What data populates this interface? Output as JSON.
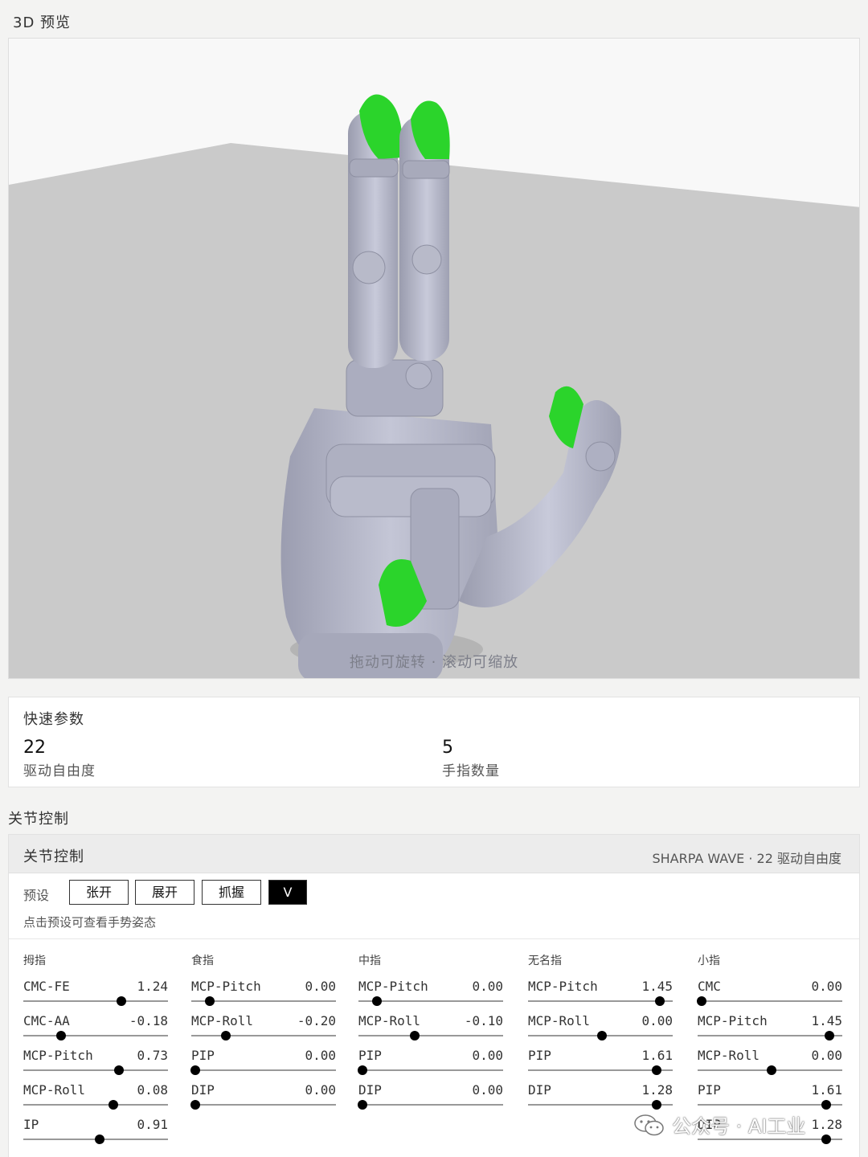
{
  "preview": {
    "section_title": "3D 预览",
    "hint": "拖动可旋转 · 滚动可缩放"
  },
  "quick": {
    "title": "快速参数",
    "stats": [
      {
        "value": "22",
        "label": "驱动自由度"
      },
      {
        "value": "5",
        "label": "手指数量"
      }
    ]
  },
  "joint": {
    "section_title": "关节控制",
    "panel_title": "关节控制",
    "model": "SHARPA WAVE · 22 驱动自由度",
    "preset_label": "预设",
    "presets": [
      "张开",
      "展开",
      "抓握",
      "V"
    ],
    "active_preset": "V",
    "preset_note": "点击预设可查看手势姿态",
    "fingers": [
      {
        "name": "拇指",
        "joints": [
          {
            "name": "CMC-FE",
            "value": "1.24",
            "pos": 0.68
          },
          {
            "name": "CMC-AA",
            "value": "-0.18",
            "pos": 0.26
          },
          {
            "name": "MCP-Pitch",
            "value": "0.73",
            "pos": 0.66
          },
          {
            "name": "MCP-Roll",
            "value": "0.08",
            "pos": 0.62
          },
          {
            "name": "IP",
            "value": "0.91",
            "pos": 0.53
          }
        ]
      },
      {
        "name": "食指",
        "joints": [
          {
            "name": "MCP-Pitch",
            "value": "0.00",
            "pos": 0.13
          },
          {
            "name": "MCP-Roll",
            "value": "-0.20",
            "pos": 0.24
          },
          {
            "name": "PIP",
            "value": "0.00",
            "pos": 0.03
          },
          {
            "name": "DIP",
            "value": "0.00",
            "pos": 0.03
          }
        ]
      },
      {
        "name": "中指",
        "joints": [
          {
            "name": "MCP-Pitch",
            "value": "0.00",
            "pos": 0.13
          },
          {
            "name": "MCP-Roll",
            "value": "-0.10",
            "pos": 0.39
          },
          {
            "name": "PIP",
            "value": "0.00",
            "pos": 0.03
          },
          {
            "name": "DIP",
            "value": "0.00",
            "pos": 0.03
          }
        ]
      },
      {
        "name": "无名指",
        "joints": [
          {
            "name": "MCP-Pitch",
            "value": "1.45",
            "pos": 0.91
          },
          {
            "name": "MCP-Roll",
            "value": "0.00",
            "pos": 0.51
          },
          {
            "name": "PIP",
            "value": "1.61",
            "pos": 0.89
          },
          {
            "name": "DIP",
            "value": "1.28",
            "pos": 0.89
          }
        ]
      },
      {
        "name": "小指",
        "joints": [
          {
            "name": "CMC",
            "value": "0.00",
            "pos": 0.03
          },
          {
            "name": "MCP-Pitch",
            "value": "1.45",
            "pos": 0.91
          },
          {
            "name": "MCP-Roll",
            "value": "0.00",
            "pos": 0.51
          },
          {
            "name": "PIP",
            "value": "1.61",
            "pos": 0.89
          },
          {
            "name": "DIP",
            "value": "1.28",
            "pos": 0.89
          }
        ]
      }
    ]
  },
  "watermark": "公众号 · AI工业",
  "colors": {
    "fingertip": "#2bd42b",
    "hand": "#b6b8c8",
    "floor": "#cbcbcb",
    "accent": "#000000"
  }
}
